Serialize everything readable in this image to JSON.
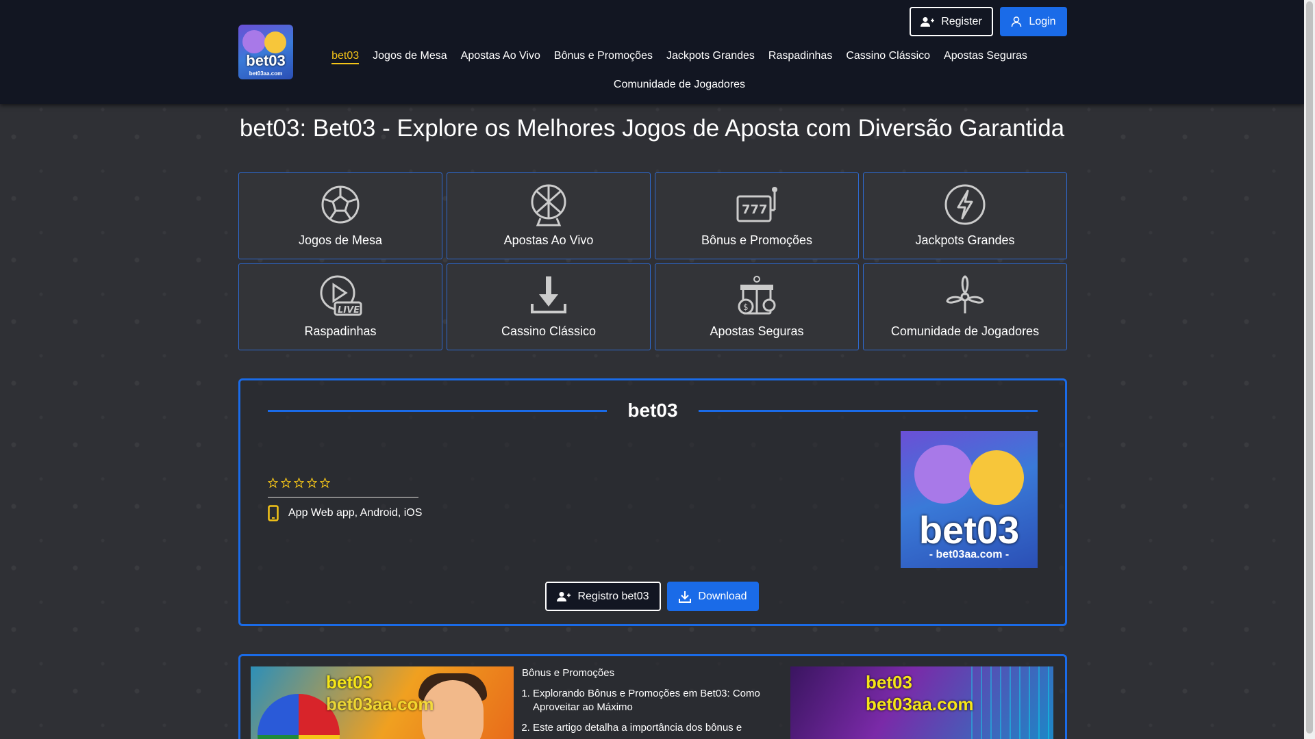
{
  "header": {
    "logo_text": "bet03",
    "logo_sub": "bet03aa.com",
    "register_label": "Register",
    "login_label": "Login",
    "nav": [
      {
        "label": "bet03",
        "active": true
      },
      {
        "label": "Jogos de Mesa"
      },
      {
        "label": "Apostas Ao Vivo"
      },
      {
        "label": "Bônus e Promoções"
      },
      {
        "label": "Jackpots Grandes"
      },
      {
        "label": "Raspadinhas"
      },
      {
        "label": "Cassino Clássico"
      },
      {
        "label": "Apostas Seguras"
      },
      {
        "label": "Comunidade de Jogadores"
      }
    ]
  },
  "page_title": "bet03: Bet03 - Explore os Melhores Jogos de Aposta com Diversão Garantida",
  "categories": [
    {
      "label": "Jogos de Mesa",
      "icon": "soccer-ball-icon"
    },
    {
      "label": "Apostas Ao Vivo",
      "icon": "lottery-ball-icon"
    },
    {
      "label": "Bônus e Promoções",
      "icon": "slot-machine-icon"
    },
    {
      "label": "Jackpots Grandes",
      "icon": "lightning-icon"
    },
    {
      "label": "Raspadinhas",
      "icon": "live-play-icon"
    },
    {
      "label": "Cassino Clássico",
      "icon": "download-arrow-icon"
    },
    {
      "label": "Apostas Seguras",
      "icon": "gift-chips-icon"
    },
    {
      "label": "Comunidade de Jogadores",
      "icon": "propeller-icon"
    }
  ],
  "app_panel": {
    "title": "bet03",
    "rating_stars": 5,
    "app_platforms": "App Web app, Android, iOS",
    "logo_text": "bet03",
    "logo_sub": "- bet03aa.com -",
    "register_label": "Registro bet03",
    "download_label": "Download"
  },
  "articles": {
    "watermark_1": "bet03",
    "watermark_2": "bet03aa.com",
    "category": "Bônus e Promoções",
    "items": [
      "Explorando Bônus e Promoções em Bet03: Como Aproveitar ao Máximo",
      "Este artigo detalha a importância dos bônus e"
    ]
  },
  "colors": {
    "accent": "#1a6be8",
    "active_nav": "#f5c518",
    "header_bg": "#121622",
    "page_bg": "#2f3035"
  }
}
